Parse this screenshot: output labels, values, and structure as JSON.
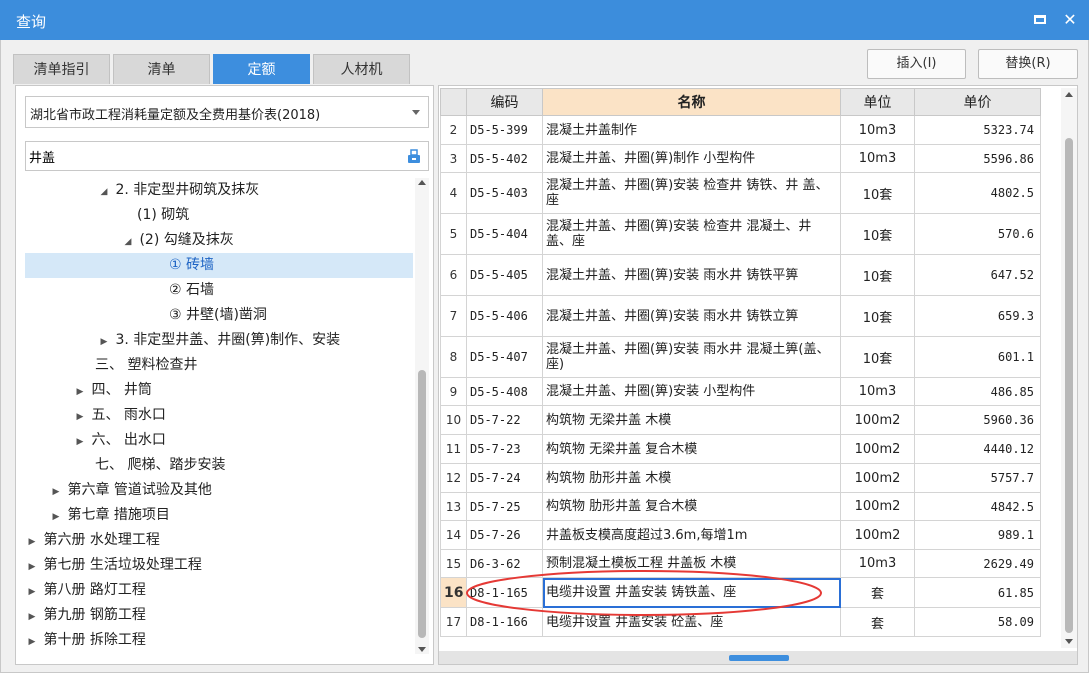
{
  "window": {
    "title": "查询"
  },
  "tabs": [
    {
      "label": "清单指引",
      "active": false
    },
    {
      "label": "清单",
      "active": false
    },
    {
      "label": "定额",
      "active": true
    },
    {
      "label": "人材机",
      "active": false
    }
  ],
  "buttons": {
    "insert": "插入(I)",
    "replace": "替换(R)"
  },
  "quota_library": "湖北省市政工程消耗量定额及全费用基价表(2018)",
  "search": {
    "value": "井盖"
  },
  "tree": [
    {
      "label": "2. 非定型井砌筑及抹灰",
      "toggle": "◢"
    },
    {
      "label": "(1) 砌筑",
      "toggle": ""
    },
    {
      "label": "(2) 勾缝及抹灰",
      "toggle": "◢"
    },
    {
      "label": "① 砖墙",
      "toggle": "",
      "selected": true
    },
    {
      "label": "② 石墙",
      "toggle": ""
    },
    {
      "label": "③ 井壁(墙)凿洞",
      "toggle": ""
    },
    {
      "label": "3. 非定型井盖、井圈(箅)制作、安装",
      "toggle": "▶"
    },
    {
      "label": "三、 塑料检查井",
      "toggle": ""
    },
    {
      "label": "四、 井筒",
      "toggle": "▶"
    },
    {
      "label": "五、 雨水口",
      "toggle": "▶"
    },
    {
      "label": "六、 出水口",
      "toggle": "▶"
    },
    {
      "label": "七、 爬梯、踏步安装",
      "toggle": ""
    },
    {
      "label": "第六章 管道试验及其他",
      "toggle": "▶"
    },
    {
      "label": "第七章 措施项目",
      "toggle": "▶"
    },
    {
      "label": "第六册 水处理工程",
      "toggle": "▶"
    },
    {
      "label": "第七册 生活垃圾处理工程",
      "toggle": "▶"
    },
    {
      "label": "第八册 路灯工程",
      "toggle": "▶"
    },
    {
      "label": "第九册 钢筋工程",
      "toggle": "▶"
    },
    {
      "label": "第十册 拆除工程",
      "toggle": "▶"
    }
  ],
  "grid": {
    "headers": [
      "",
      "编码",
      "名称",
      "单位",
      "单价"
    ],
    "rows": [
      {
        "n": "2",
        "code": "D5-5-399",
        "name": "混凝土井盖制作",
        "unit": "10m3",
        "price": "5323.74"
      },
      {
        "n": "3",
        "code": "D5-5-402",
        "name": "混凝土井盖、井圈(箅)制作 小型构件",
        "unit": "10m3",
        "price": "5596.86"
      },
      {
        "n": "4",
        "code": "D5-5-403",
        "name": "混凝土井盖、井圈(箅)安装 检查井 铸铁、井 盖、座",
        "unit": "10套",
        "price": "4802.5"
      },
      {
        "n": "5",
        "code": "D5-5-404",
        "name": "混凝土井盖、井圈(箅)安装 检查井 混凝土、井 盖、座",
        "unit": "10套",
        "price": "570.6"
      },
      {
        "n": "6",
        "code": "D5-5-405",
        "name": "混凝土井盖、井圈(箅)安装 雨水井 铸铁平箅",
        "unit": "10套",
        "price": "647.52"
      },
      {
        "n": "7",
        "code": "D5-5-406",
        "name": "混凝土井盖、井圈(箅)安装 雨水井 铸铁立箅",
        "unit": "10套",
        "price": "659.3"
      },
      {
        "n": "8",
        "code": "D5-5-407",
        "name": "混凝土井盖、井圈(箅)安装 雨水井 混凝土箅(盖、座)",
        "unit": "10套",
        "price": "601.1"
      },
      {
        "n": "9",
        "code": "D5-5-408",
        "name": "混凝土井盖、井圈(箅)安装 小型构件",
        "unit": "10m3",
        "price": "486.85"
      },
      {
        "n": "10",
        "code": "D5-7-22",
        "name": "构筑物 无梁井盖 木模",
        "unit": "100m2",
        "price": "5960.36"
      },
      {
        "n": "11",
        "code": "D5-7-23",
        "name": "构筑物 无梁井盖 复合木模",
        "unit": "100m2",
        "price": "4440.12"
      },
      {
        "n": "12",
        "code": "D5-7-24",
        "name": "构筑物 肋形井盖 木模",
        "unit": "100m2",
        "price": "5757.7"
      },
      {
        "n": "13",
        "code": "D5-7-25",
        "name": "构筑物 肋形井盖 复合木模",
        "unit": "100m2",
        "price": "4842.5"
      },
      {
        "n": "14",
        "code": "D5-7-26",
        "name": "井盖板支模高度超过3.6m,每增1m",
        "unit": "100m2",
        "price": "989.1"
      },
      {
        "n": "15",
        "code": "D6-3-62",
        "name": "预制混凝土模板工程 井盖板 木模",
        "unit": "10m3",
        "price": "2629.49"
      },
      {
        "n": "16",
        "code": "D8-1-165",
        "name": "电缆井设置 井盖安装 铸铁盖、座",
        "unit": "套",
        "price": "61.85",
        "current": true
      },
      {
        "n": "17",
        "code": "D8-1-166",
        "name": "电缆井设置 井盖安装 砼盖、座",
        "unit": "套",
        "price": "58.09"
      }
    ]
  },
  "colors": {
    "accent": "#3d8ede",
    "highlight": "#fbe3c6",
    "annotation": "#e53935"
  }
}
